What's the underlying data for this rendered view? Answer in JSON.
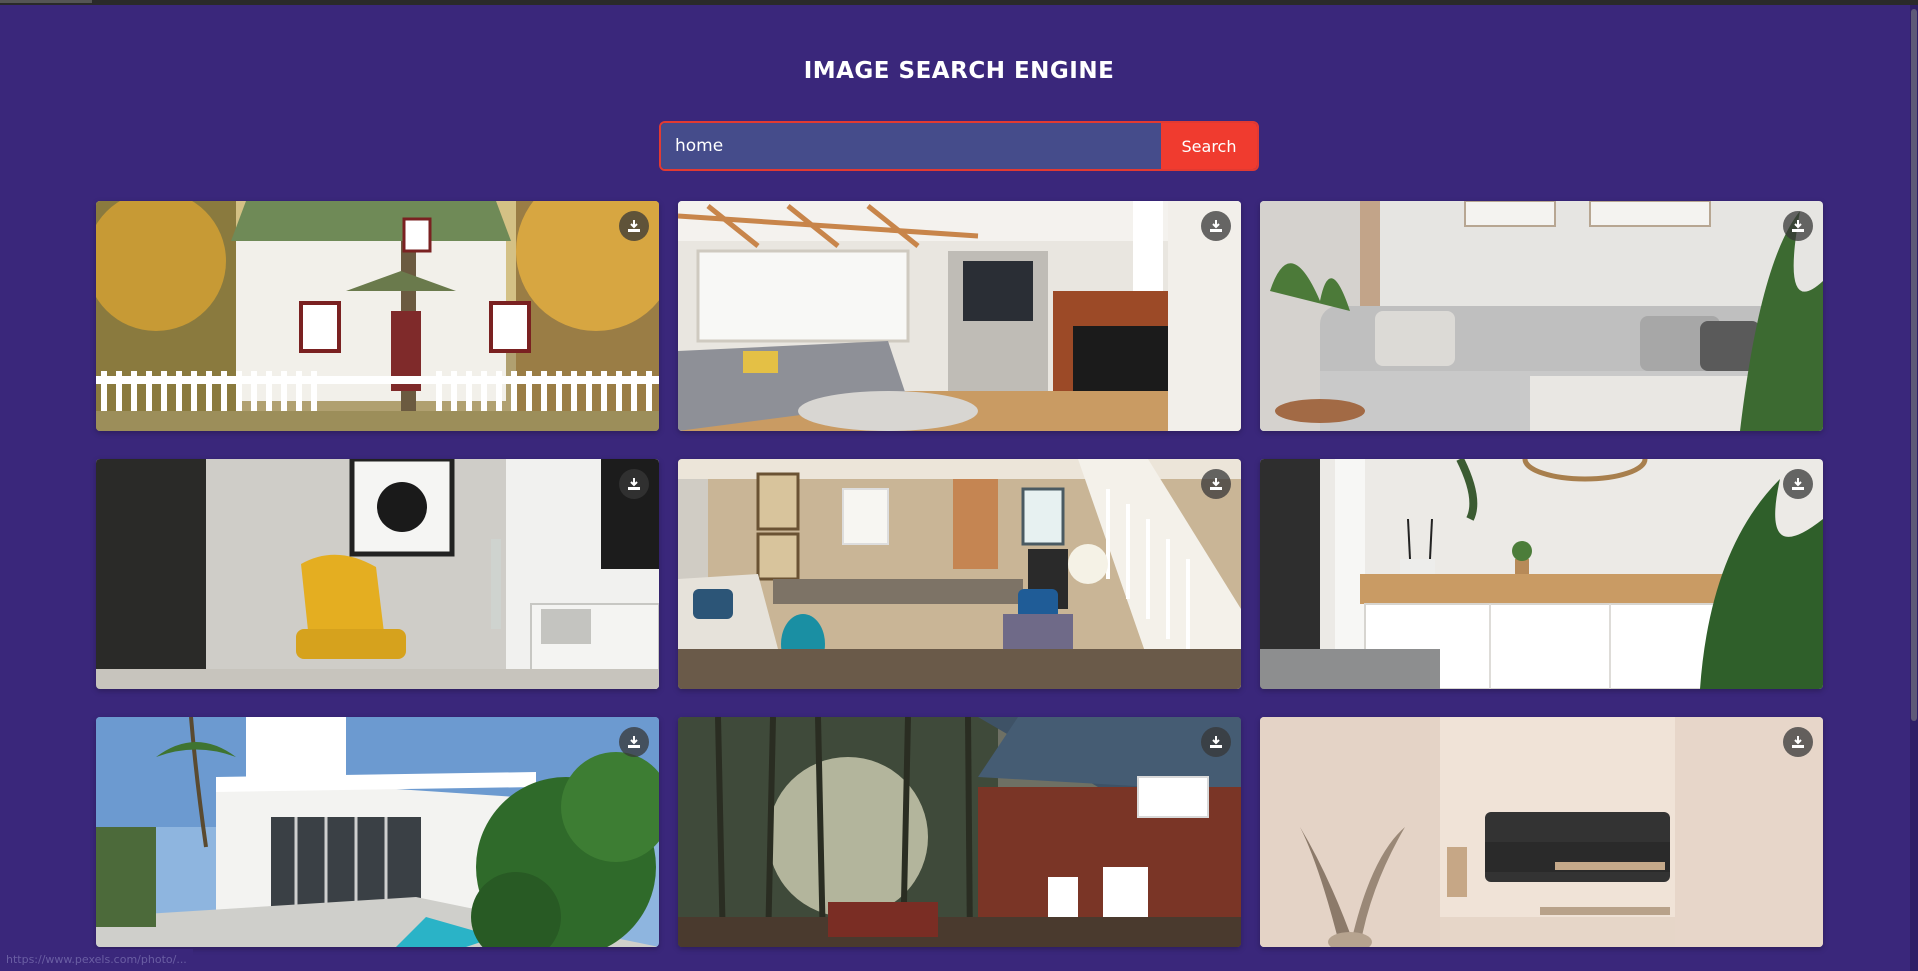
{
  "app": {
    "title": "IMAGE SEARCH ENGINE"
  },
  "search": {
    "value": "home",
    "button_label": "Search"
  },
  "results": [
    {
      "name": "house-exterior-white",
      "icon": "download-icon"
    },
    {
      "name": "living-room-fireplace",
      "icon": "download-icon"
    },
    {
      "name": "grey-sofa",
      "icon": "download-icon"
    },
    {
      "name": "yellow-armchair",
      "icon": "download-icon"
    },
    {
      "name": "living-room-stairs",
      "icon": "download-icon"
    },
    {
      "name": "sideboard-plant",
      "icon": "download-icon"
    },
    {
      "name": "modern-villa",
      "icon": "download-icon"
    },
    {
      "name": "log-house-forest",
      "icon": "download-icon"
    },
    {
      "name": "beige-room-sofa",
      "icon": "download-icon"
    }
  ],
  "status_bar": {
    "url": "https://www.pexels.com/photo/..."
  },
  "colors": {
    "background": "#3a277b",
    "accent": "#f03b2f",
    "input": "#454c8b"
  }
}
